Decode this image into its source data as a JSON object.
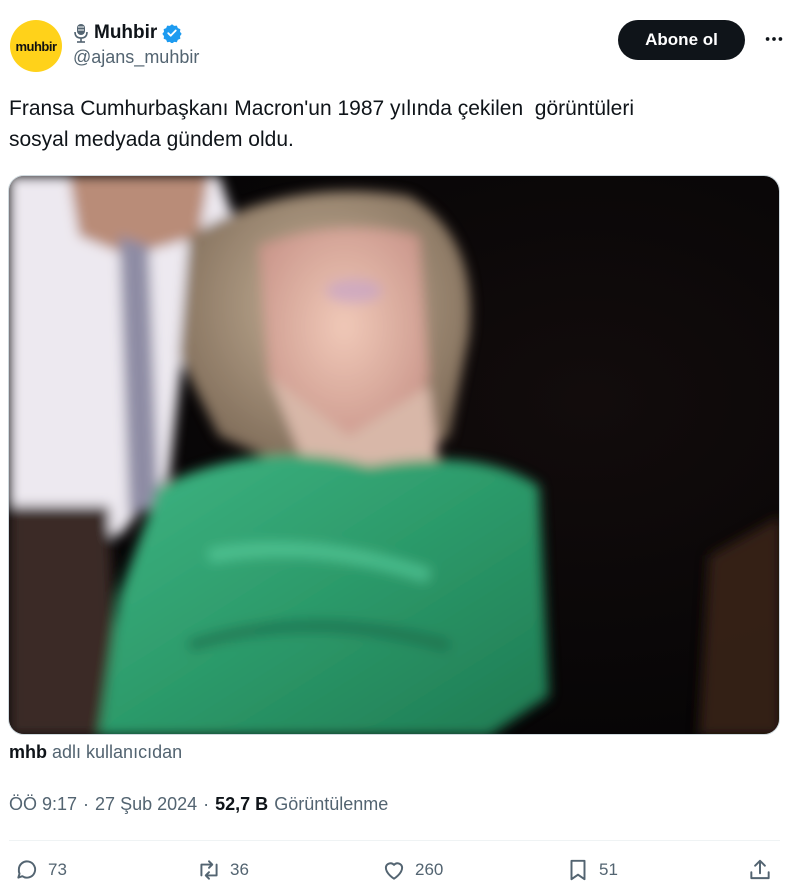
{
  "author": {
    "avatar_text": "muhbir",
    "display_name": "Muhbir",
    "handle": "@ajans_muhbir",
    "mic_icon": "microphone-icon",
    "verified_icon": "verified-badge-icon"
  },
  "follow_label": "Abone ol",
  "tweet_text": "Fransa Cumhurbaşkanı Macron'un 1987 yılında çekilen  görüntüleri\nsosyal medyada gündem oldu.",
  "media": {
    "description_icon": "video-still"
  },
  "source": {
    "user": "mhb",
    "suffix": "adlı kullanıcıdan"
  },
  "meta": {
    "time": "ÖÖ 9:17",
    "date": "27 Şub 2024",
    "views_count": "52,7 B",
    "views_label": "Görüntülenme",
    "sep": "·"
  },
  "actions": {
    "replies": "73",
    "reposts": "36",
    "likes": "260",
    "bookmarks": "51"
  },
  "colors": {
    "accent": "#1d9bf0",
    "text": "#0f1419",
    "muted": "#536471",
    "avatar_bg": "#ffd21a"
  }
}
